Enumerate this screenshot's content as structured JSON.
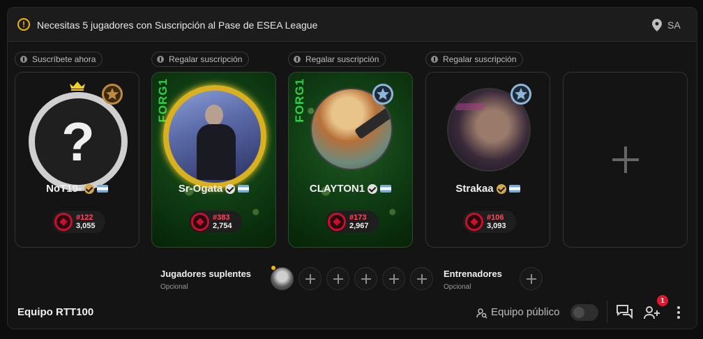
{
  "banner": {
    "message": "Necesitas 5 jugadores con Suscripción al Pase de ESEA League",
    "region": "SA",
    "icons": {
      "warning": "warning-icon",
      "location": "location-pin-icon"
    }
  },
  "players": [
    {
      "pill": "Suscríbete ahora",
      "name": "NoT19-",
      "rank": "#122",
      "elo": "3,055",
      "placeholder_avatar": "?",
      "crown": true,
      "has_bg": false,
      "badge_color": "#c08a3e"
    },
    {
      "pill": "Regalar suscripción",
      "name": "Sr-Ogata",
      "rank": "#383",
      "elo": "2,754",
      "forg": "FORG1",
      "has_bg": true,
      "frame": "gold"
    },
    {
      "pill": "Regalar suscripción",
      "name": "CLAYTON1",
      "rank": "#173",
      "elo": "2,967",
      "forg": "FORG1",
      "has_bg": true,
      "badge_color": "#8fb6d9"
    },
    {
      "pill": "Regalar suscripción",
      "name": "Strakaa",
      "rank": "#106",
      "elo": "3,093",
      "has_bg": false,
      "badge_color": "#8fb6d9"
    }
  ],
  "substitutes": {
    "label": "Jugadores suplentes",
    "sublabel": "Opcional",
    "open_slots": 5
  },
  "coaches": {
    "label": "Entrenadores",
    "sublabel": "Opcional"
  },
  "footer": {
    "team_name": "Equipo RTT100",
    "public_label": "Equipo público",
    "public_enabled": false,
    "invite_badge": "1"
  },
  "colors": {
    "accent_red": "#e0172f",
    "warning": "#f2b600",
    "forg_green": "#2fcf4a"
  }
}
